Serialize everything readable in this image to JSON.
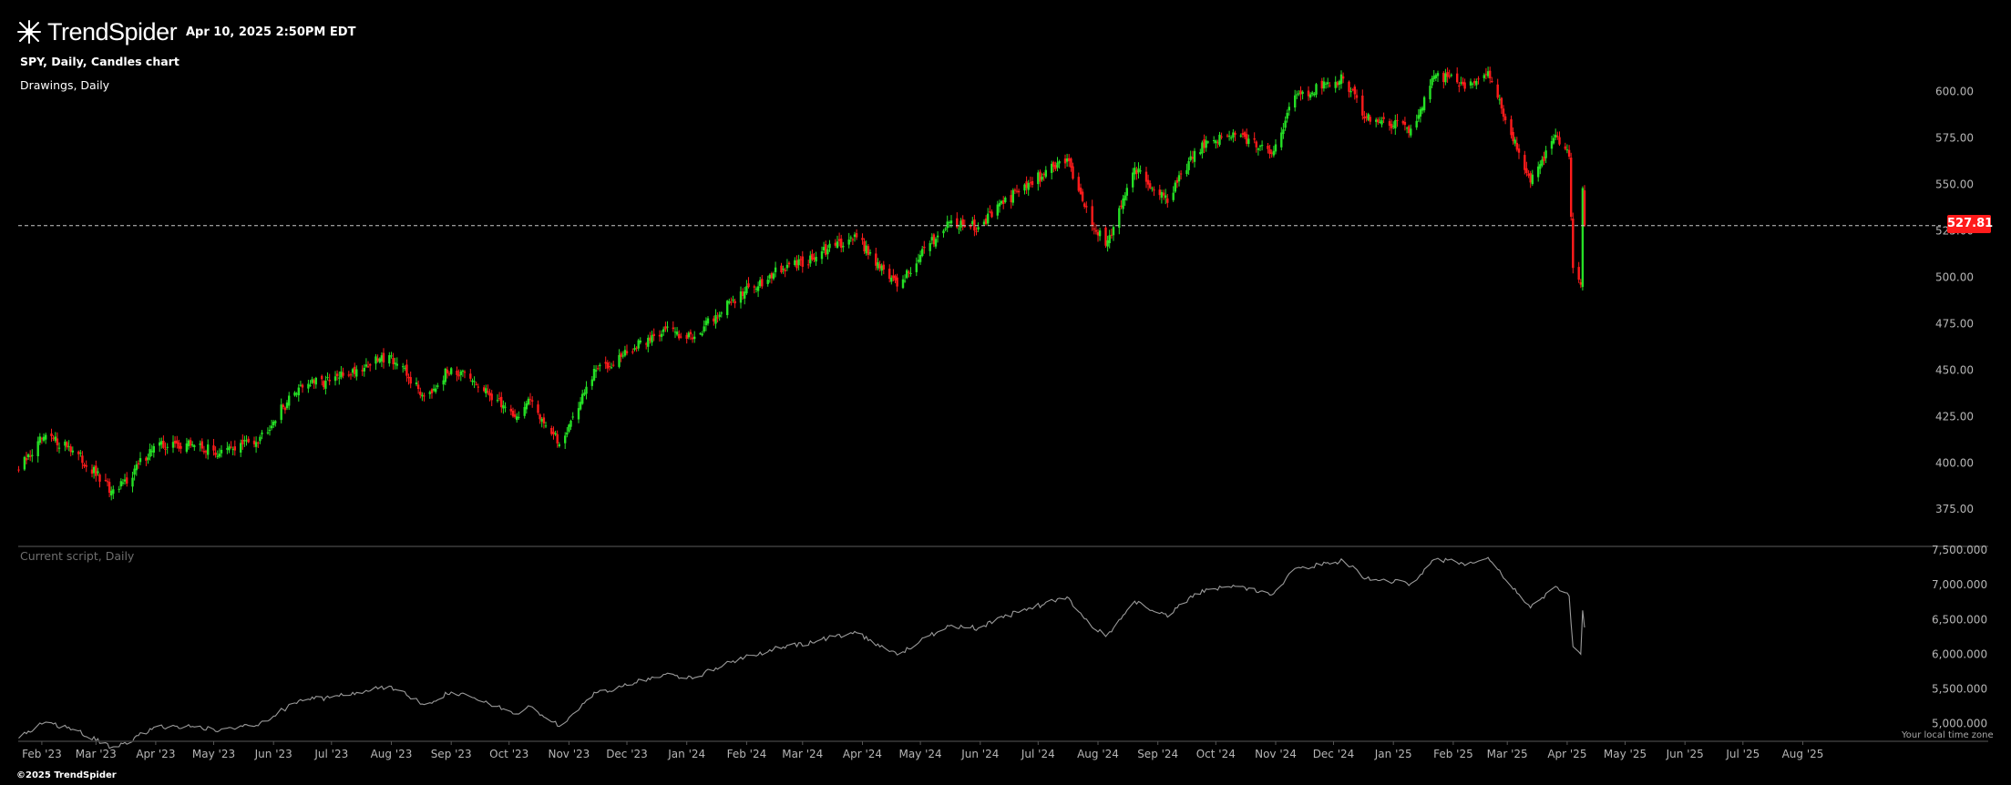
{
  "header": {
    "logo_text": "TrendSpider",
    "datetime": "Apr 10, 2025 2:50PM EDT",
    "chart_title": "SPY, Daily, Candles chart",
    "drawings_label": "Drawings, Daily"
  },
  "indicator": {
    "title": "Current script, Daily"
  },
  "footer": {
    "copyright": "©2025 TrendSpider",
    "local_tz": "Your local time zone"
  },
  "current_price": "527.81",
  "colors": {
    "up": "#25e025",
    "down": "#ff1b1b",
    "line": "#9a9a9a",
    "axis_text": "#b5b5b5",
    "background": "#000000"
  },
  "chart_data": [
    {
      "type": "candlestick",
      "symbol": "SPY",
      "interval": "Daily",
      "y_ticks": [
        "600.00",
        "575.00",
        "550.00",
        "525.00",
        "500.00",
        "475.00",
        "450.00",
        "425.00",
        "400.00",
        "375.00"
      ],
      "ylim": [
        355,
        615
      ],
      "x_ticks": [
        "Feb '23",
        "Mar '23",
        "Apr '23",
        "May '23",
        "Jun '23",
        "Jul '23",
        "Aug '23",
        "Sep '23",
        "Oct '23",
        "Nov '23",
        "Dec '23",
        "Jan '24",
        "Feb '24",
        "Mar '24",
        "Apr '24",
        "May '24",
        "Jun '24",
        "Jul '24",
        "Aug '24",
        "Sep '24",
        "Oct '24",
        "Nov '24",
        "Dec '24",
        "Jan '25",
        "Feb '25",
        "Mar '25",
        "Apr '25",
        "May '25",
        "Jun '25",
        "Jul '25",
        "Aug '25"
      ],
      "close_anchors": [
        [
          "2023-01-20",
          396
        ],
        [
          "2023-02-02",
          414
        ],
        [
          "2023-02-15",
          409
        ],
        [
          "2023-03-09",
          385
        ],
        [
          "2023-03-13",
          386
        ],
        [
          "2023-03-31",
          409
        ],
        [
          "2023-04-20",
          410
        ],
        [
          "2023-05-04",
          405
        ],
        [
          "2023-05-25",
          414
        ],
        [
          "2023-06-15",
          442
        ],
        [
          "2023-06-30",
          444
        ],
        [
          "2023-07-31",
          458
        ],
        [
          "2023-08-18",
          436
        ],
        [
          "2023-09-01",
          451
        ],
        [
          "2023-09-20",
          438
        ],
        [
          "2023-10-05",
          425
        ],
        [
          "2023-10-12",
          434
        ],
        [
          "2023-10-27",
          410
        ],
        [
          "2023-11-15",
          450
        ],
        [
          "2023-12-01",
          459
        ],
        [
          "2023-12-20",
          472
        ],
        [
          "2024-01-05",
          468
        ],
        [
          "2024-01-25",
          488
        ],
        [
          "2024-02-15",
          502
        ],
        [
          "2024-03-08",
          511
        ],
        [
          "2024-03-28",
          523
        ],
        [
          "2024-04-19",
          495
        ],
        [
          "2024-05-15",
          530
        ],
        [
          "2024-05-31",
          527
        ],
        [
          "2024-06-20",
          546
        ],
        [
          "2024-07-16",
          564
        ],
        [
          "2024-07-25",
          538
        ],
        [
          "2024-08-05",
          517
        ],
        [
          "2024-08-20",
          559
        ],
        [
          "2024-09-06",
          540
        ],
        [
          "2024-09-20",
          568
        ],
        [
          "2024-10-10",
          578
        ],
        [
          "2024-10-31",
          568
        ],
        [
          "2024-11-11",
          598
        ],
        [
          "2024-12-06",
          607
        ],
        [
          "2024-12-18",
          586
        ],
        [
          "2025-01-10",
          580
        ],
        [
          "2025-01-23",
          609
        ],
        [
          "2025-02-06",
          604
        ],
        [
          "2025-02-19",
          611
        ],
        [
          "2025-03-13",
          551
        ],
        [
          "2025-03-25",
          575
        ],
        [
          "2025-04-02",
          565
        ],
        [
          "2025-04-04",
          505
        ],
        [
          "2025-04-08",
          496
        ],
        [
          "2025-04-09",
          548
        ],
        [
          "2025-04-10",
          527.81
        ]
      ]
    },
    {
      "type": "line",
      "title": "Current script, Daily",
      "y_ticks": [
        "7,500.000",
        "7,000.000",
        "6,500.000",
        "6,000.000",
        "5,500.000",
        "5,000.000"
      ],
      "ylim": [
        4800,
        7500
      ],
      "note": "values = close × 12.1"
    }
  ]
}
